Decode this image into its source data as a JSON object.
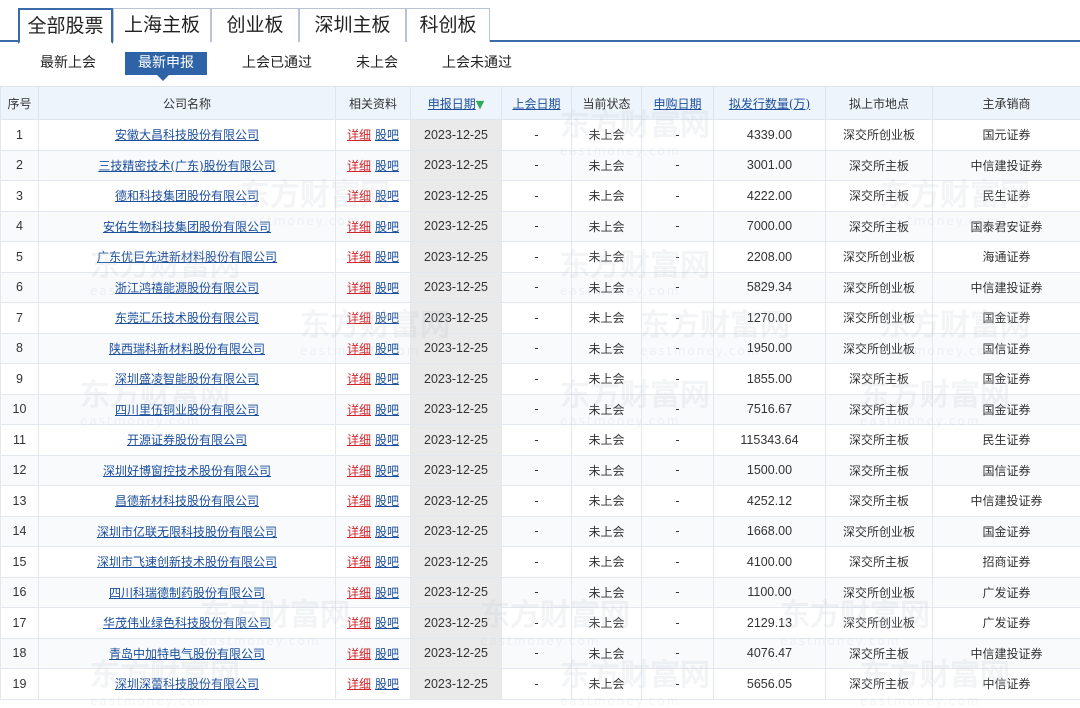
{
  "market_tabs": [
    {
      "label": "全部股票",
      "active": true
    },
    {
      "label": "上海主板",
      "active": false
    },
    {
      "label": "创业板",
      "active": false
    },
    {
      "label": "深圳主板",
      "active": false
    },
    {
      "label": "科创板",
      "active": false
    }
  ],
  "sub_tabs": [
    {
      "label": "最新上会",
      "active": false
    },
    {
      "label": "最新申报",
      "active": true
    },
    {
      "label": "上会已通过",
      "active": false
    },
    {
      "label": "未上会",
      "active": false
    },
    {
      "label": "上会未通过",
      "active": false
    }
  ],
  "table": {
    "headers": {
      "index": "序号",
      "company": "公司名称",
      "resources": "相关资料",
      "report_date": "申报日期",
      "meeting_date": "上会日期",
      "status": "当前状态",
      "subscribe_date": "申购日期",
      "issue_qty": "拟发行数量(万)",
      "listing_place": "拟上市地点",
      "underwriter": "主承销商"
    },
    "link_labels": {
      "detail": "详细",
      "guba": "股吧"
    },
    "rows": [
      {
        "no": "1",
        "company": "安徽大昌科技股份有限公司",
        "date": "2023-12-25",
        "meeting": "-",
        "status": "未上会",
        "subscribe": "-",
        "qty": "4339.00",
        "place": "深交所创业板",
        "underwriter": "国元证券"
      },
      {
        "no": "2",
        "company": "三技精密技术(广东)股份有限公司",
        "date": "2023-12-25",
        "meeting": "-",
        "status": "未上会",
        "subscribe": "-",
        "qty": "3001.00",
        "place": "深交所主板",
        "underwriter": "中信建投证券"
      },
      {
        "no": "3",
        "company": "德和科技集团股份有限公司",
        "date": "2023-12-25",
        "meeting": "-",
        "status": "未上会",
        "subscribe": "-",
        "qty": "4222.00",
        "place": "深交所主板",
        "underwriter": "民生证券"
      },
      {
        "no": "4",
        "company": "安佑生物科技集团股份有限公司",
        "date": "2023-12-25",
        "meeting": "-",
        "status": "未上会",
        "subscribe": "-",
        "qty": "7000.00",
        "place": "深交所主板",
        "underwriter": "国泰君安证券"
      },
      {
        "no": "5",
        "company": "广东优巨先进新材料股份有限公司",
        "date": "2023-12-25",
        "meeting": "-",
        "status": "未上会",
        "subscribe": "-",
        "qty": "2208.00",
        "place": "深交所创业板",
        "underwriter": "海通证券"
      },
      {
        "no": "6",
        "company": "浙江鸿禧能源股份有限公司",
        "date": "2023-12-25",
        "meeting": "-",
        "status": "未上会",
        "subscribe": "-",
        "qty": "5829.34",
        "place": "深交所创业板",
        "underwriter": "中信建投证券"
      },
      {
        "no": "7",
        "company": "东莞汇乐技术股份有限公司",
        "date": "2023-12-25",
        "meeting": "-",
        "status": "未上会",
        "subscribe": "-",
        "qty": "1270.00",
        "place": "深交所创业板",
        "underwriter": "国金证券"
      },
      {
        "no": "8",
        "company": "陕西瑞科新材料股份有限公司",
        "date": "2023-12-25",
        "meeting": "-",
        "status": "未上会",
        "subscribe": "-",
        "qty": "1950.00",
        "place": "深交所创业板",
        "underwriter": "国信证券"
      },
      {
        "no": "9",
        "company": "深圳盛凌智能股份有限公司",
        "date": "2023-12-25",
        "meeting": "-",
        "status": "未上会",
        "subscribe": "-",
        "qty": "1855.00",
        "place": "深交所主板",
        "underwriter": "国金证券"
      },
      {
        "no": "10",
        "company": "四川里伍铜业股份有限公司",
        "date": "2023-12-25",
        "meeting": "-",
        "status": "未上会",
        "subscribe": "-",
        "qty": "7516.67",
        "place": "深交所主板",
        "underwriter": "国金证券"
      },
      {
        "no": "11",
        "company": "开源证券股份有限公司",
        "date": "2023-12-25",
        "meeting": "-",
        "status": "未上会",
        "subscribe": "-",
        "qty": "115343.64",
        "place": "深交所主板",
        "underwriter": "民生证券"
      },
      {
        "no": "12",
        "company": "深圳好博窗控技术股份有限公司",
        "date": "2023-12-25",
        "meeting": "-",
        "status": "未上会",
        "subscribe": "-",
        "qty": "1500.00",
        "place": "深交所主板",
        "underwriter": "国信证券"
      },
      {
        "no": "13",
        "company": "昌德新材科技股份有限公司",
        "date": "2023-12-25",
        "meeting": "-",
        "status": "未上会",
        "subscribe": "-",
        "qty": "4252.12",
        "place": "深交所主板",
        "underwriter": "中信建投证券"
      },
      {
        "no": "14",
        "company": "深圳市亿联无限科技股份有限公司",
        "date": "2023-12-25",
        "meeting": "-",
        "status": "未上会",
        "subscribe": "-",
        "qty": "1668.00",
        "place": "深交所创业板",
        "underwriter": "国金证券"
      },
      {
        "no": "15",
        "company": "深圳市飞速创新技术股份有限公司",
        "date": "2023-12-25",
        "meeting": "-",
        "status": "未上会",
        "subscribe": "-",
        "qty": "4100.00",
        "place": "深交所主板",
        "underwriter": "招商证券"
      },
      {
        "no": "16",
        "company": "四川科瑞德制药股份有限公司",
        "date": "2023-12-25",
        "meeting": "-",
        "status": "未上会",
        "subscribe": "-",
        "qty": "1100.00",
        "place": "深交所创业板",
        "underwriter": "广发证券"
      },
      {
        "no": "17",
        "company": "华茂伟业绿色科技股份有限公司",
        "date": "2023-12-25",
        "meeting": "-",
        "status": "未上会",
        "subscribe": "-",
        "qty": "2129.13",
        "place": "深交所创业板",
        "underwriter": "广发证券"
      },
      {
        "no": "18",
        "company": "青岛中加特电气股份有限公司",
        "date": "2023-12-25",
        "meeting": "-",
        "status": "未上会",
        "subscribe": "-",
        "qty": "4076.47",
        "place": "深交所主板",
        "underwriter": "中信建投证券"
      },
      {
        "no": "19",
        "company": "深圳深蕾科技股份有限公司",
        "date": "2023-12-25",
        "meeting": "-",
        "status": "未上会",
        "subscribe": "-",
        "qty": "5656.05",
        "place": "深交所主板",
        "underwriter": "中信证券"
      }
    ]
  },
  "watermark": {
    "text": "东方财富网",
    "sub": "eastmoney.com"
  }
}
